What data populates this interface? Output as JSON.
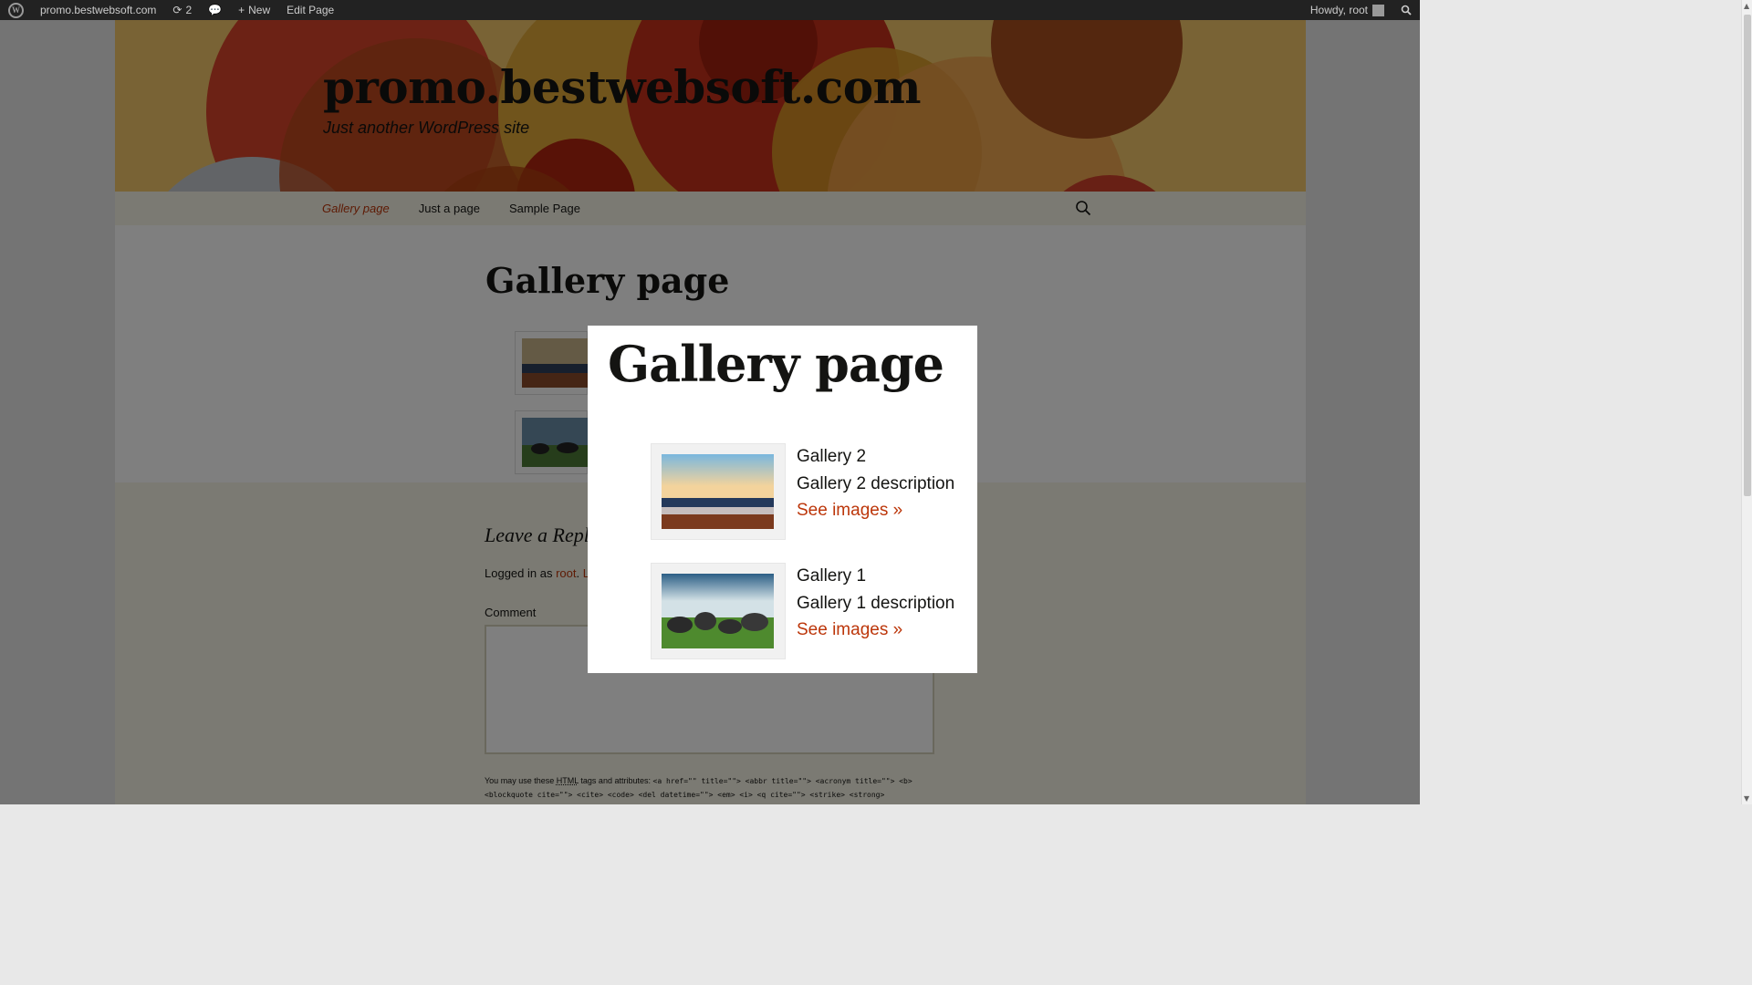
{
  "admin_bar": {
    "site_name": "promo.bestwebsoft.com",
    "updates_count": "2",
    "new_label": "New",
    "edit_label": "Edit Page",
    "howdy": "Howdy, root"
  },
  "header": {
    "site_title": "promo.bestwebsoft.com",
    "site_description": "Just another WordPress site"
  },
  "nav": {
    "items": [
      {
        "label": "Gallery page"
      },
      {
        "label": "Just a page"
      },
      {
        "label": "Sample Page"
      }
    ]
  },
  "page": {
    "title": "Gallery page"
  },
  "comments": {
    "reply_title": "Leave a Repl",
    "logged_prefix": "Logged in as",
    "logged_user": "root",
    "logged_suffix_link": "Lo",
    "comment_label": "Comment",
    "allowed_prefix": "You may use these",
    "allowed_html": "HTML",
    "allowed_middle": "tags and attributes:",
    "allowed_code_1": "<a href=\"\" title=\"\"> <abbr title=\"\"> <acronym title=\"\"> <b>",
    "allowed_code_2": "<blockquote cite=\"\"> <cite> <code> <del datetime=\"\"> <em> <i> <q cite=\"\"> <strike> <strong>"
  },
  "lightbox": {
    "title": "Gallery page",
    "galleries": [
      {
        "name": "Gallery 2",
        "description": "Gallery 2 description",
        "link": "See images »"
      },
      {
        "name": "Gallery 1",
        "description": "Gallery 1 description",
        "link": "See images »"
      }
    ]
  },
  "colors": {
    "accent": "#bc360a",
    "header_bg": "#f2c76a",
    "nav_bg": "#f7f5e7",
    "admin_bar": "#222222"
  }
}
